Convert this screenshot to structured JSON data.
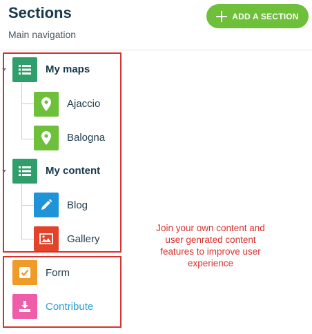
{
  "header": {
    "title": "Sections",
    "subtitle": "Main navigation",
    "add_button_label": "ADD A SECTION"
  },
  "sections": [
    {
      "label": "My maps",
      "icon": "list-icon",
      "color": "#2f9e6a",
      "level": 0
    },
    {
      "label": "Ajaccio",
      "icon": "map-pin-icon",
      "color": "#6ebf3a",
      "level": 1
    },
    {
      "label": "Balogna",
      "icon": "map-pin-icon",
      "color": "#6ebf3a",
      "level": 1
    },
    {
      "label": "My content",
      "icon": "list-icon",
      "color": "#2f9e6a",
      "level": 0
    },
    {
      "label": "Blog",
      "icon": "pencil-icon",
      "color": "#1e93d7",
      "level": 1
    },
    {
      "label": "Gallery",
      "icon": "image-icon",
      "color": "#e3432b",
      "level": 1
    },
    {
      "label": "Form",
      "icon": "checkbox-icon",
      "color": "#f09a27",
      "level": 0
    },
    {
      "label": "Contribute",
      "icon": "download-icon",
      "color": "#ef5ca9",
      "level": 0
    }
  ],
  "annotation": {
    "text": "Join your own content and user genrated content features to improve user experience",
    "color": "#d8312d"
  },
  "colors": {
    "accent": "#6ebf3a",
    "highlight": "#d8312d",
    "link": "#2a9fd6"
  }
}
